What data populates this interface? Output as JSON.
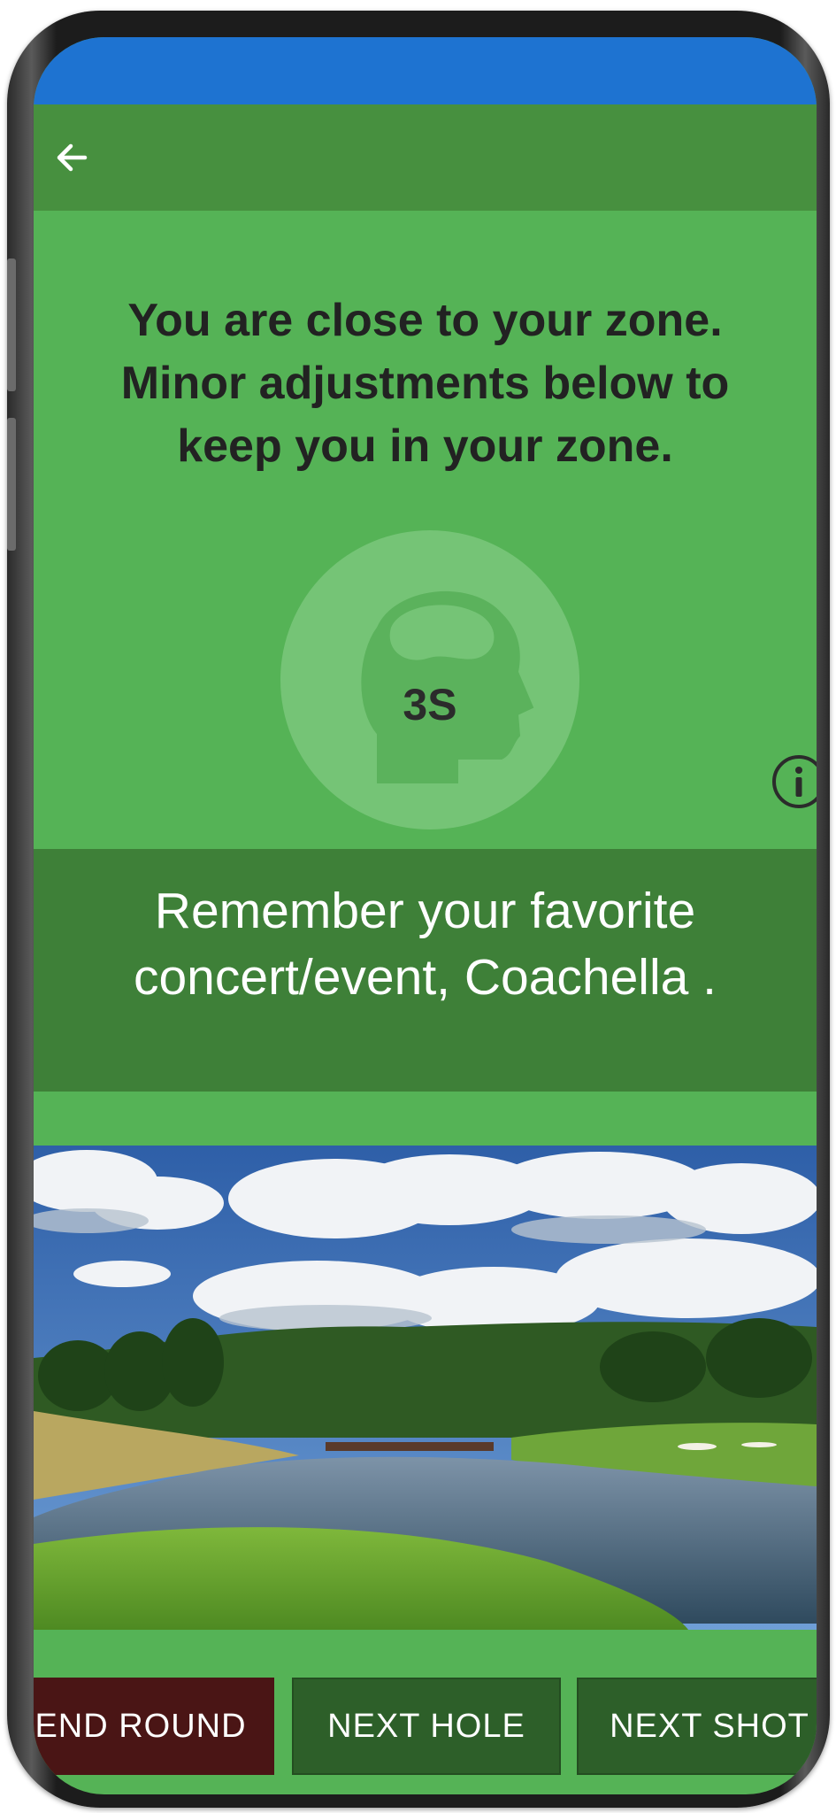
{
  "colors": {
    "statusbar": "#1e73d1",
    "appbar": "#47903f",
    "background": "#55b356",
    "tip_band": "#3e8038",
    "end_round": "#4a1515",
    "nav_buttons": "#2d5f29"
  },
  "appbar": {
    "back_icon": "arrow-left-icon"
  },
  "headline": {
    "line1": "You are close to your zone.",
    "line2": "Minor adjustments below to",
    "line3": "keep you in your zone."
  },
  "zone": {
    "icon": "head-profile-icon",
    "label": "3S"
  },
  "info": {
    "icon": "info-icon"
  },
  "tip": {
    "line1": "Remember your favorite",
    "line2": "concert/event, Coachella ."
  },
  "photo": {
    "subject": "golf-course-landscape"
  },
  "buttons": {
    "end_round": "END ROUND",
    "next_hole": "NEXT HOLE",
    "next_shot": "NEXT SHOT"
  }
}
